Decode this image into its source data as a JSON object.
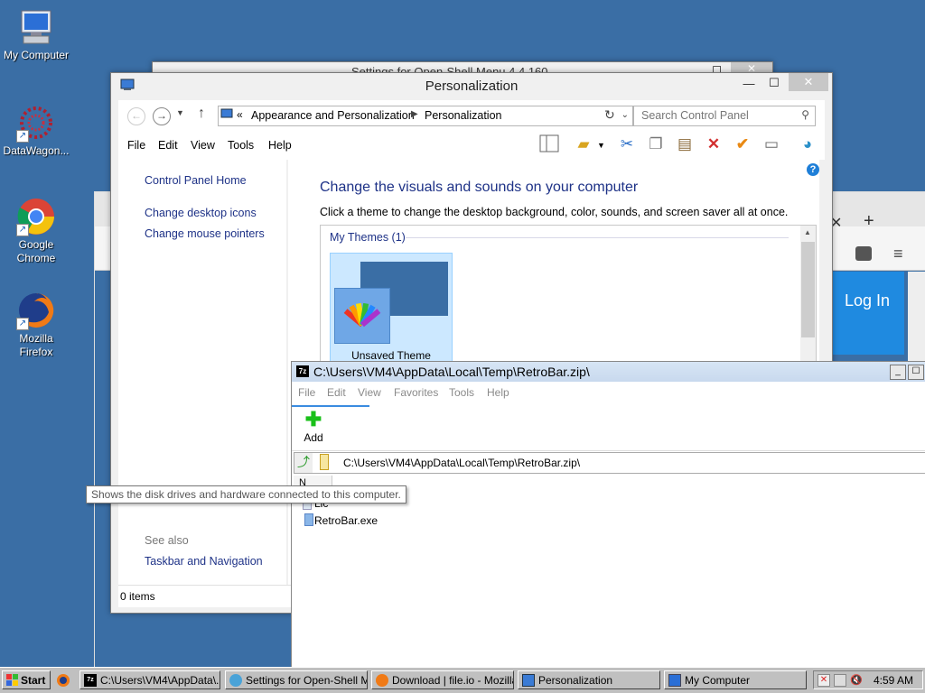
{
  "desktop": {
    "icons": [
      {
        "label": "My Computer"
      },
      {
        "label": "DataWagon..."
      },
      {
        "label": "Google Chrome"
      },
      {
        "label": "Mozilla Firefox"
      }
    ]
  },
  "background_windows": {
    "openshell_title": "Settings for Open-Shell Menu 4.4.160",
    "firefox_login": "Log In"
  },
  "personalization": {
    "title": "Personalization",
    "breadcrumb": [
      "Appearance and Personalization",
      "Personalization"
    ],
    "search_placeholder": "Search Control Panel",
    "menu": [
      "File",
      "Edit",
      "View",
      "Tools",
      "Help"
    ],
    "left_links": [
      "Control Panel Home",
      "Change desktop icons",
      "Change mouse pointers"
    ],
    "see_also_label": "See also",
    "see_also_links": [
      "Taskbar and Navigation"
    ],
    "heading": "Change the visuals and sounds on your computer",
    "description": "Click a theme to change the desktop background, color, sounds, and screen saver all at once.",
    "themes_group": "My Themes (1)",
    "theme_name": "Unsaved Theme",
    "status": "0 items",
    "help_glyph": "?"
  },
  "zip": {
    "title": "C:\\Users\\VM4\\AppData\\Local\\Temp\\RetroBar.zip\\",
    "menu": [
      "File",
      "Edit",
      "View",
      "Favorites",
      "Tools",
      "Help"
    ],
    "add_label": "Add",
    "path": "C:\\Users\\VM4\\AppData\\Local\\Temp\\RetroBar.zip\\",
    "files": [
      "Lic",
      "RetroBar.exe"
    ],
    "column_header": "N"
  },
  "tooltip": "Shows the disk drives and hardware connected to this computer.",
  "taskbar": {
    "start": "Start",
    "buttons": [
      "C:\\Users\\VM4\\AppData\\...",
      "Settings for Open-Shell M...",
      "Download | file.io - Mozilla...",
      "Personalization",
      "My Computer"
    ],
    "clock": "4:59 AM"
  },
  "colors": {
    "desktop": "#3a6ea5",
    "link": "#1e3287",
    "heading": "#1e3287",
    "accent": "#3a6ea5"
  }
}
